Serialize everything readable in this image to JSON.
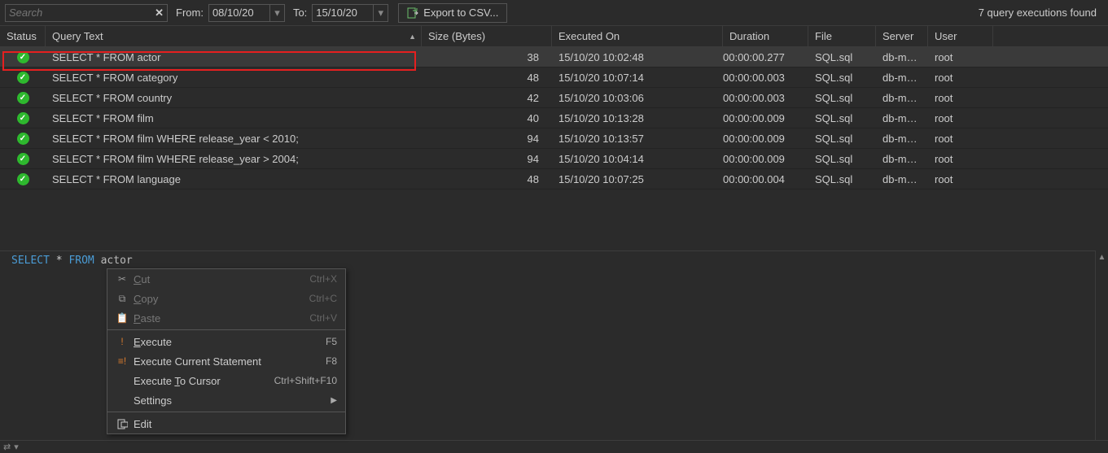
{
  "toolbar": {
    "search_placeholder": "Search",
    "from_label": "From:",
    "from_value": "08/10/20",
    "to_label": "To:",
    "to_value": "15/10/20",
    "export_label": "Export to CSV...",
    "count_label": "7 query executions found"
  },
  "columns": {
    "status": "Status",
    "query": "Query Text",
    "size": "Size (Bytes)",
    "executed": "Executed On",
    "duration": "Duration",
    "file": "File",
    "server": "Server",
    "user": "User"
  },
  "rows": [
    {
      "status": "ok",
      "query": "SELECT * FROM actor",
      "size": "38",
      "executed": "15/10/20 10:02:48",
      "duration": "00:00:00.277",
      "file": "SQL.sql",
      "server": "db-mysql...",
      "user": "root",
      "selected": true
    },
    {
      "status": "ok",
      "query": "SELECT * FROM category",
      "size": "48",
      "executed": "15/10/20 10:07:14",
      "duration": "00:00:00.003",
      "file": "SQL.sql",
      "server": "db-mysql...",
      "user": "root"
    },
    {
      "status": "ok",
      "query": "SELECT * FROM country",
      "size": "42",
      "executed": "15/10/20 10:03:06",
      "duration": "00:00:00.003",
      "file": "SQL.sql",
      "server": "db-mysql...",
      "user": "root"
    },
    {
      "status": "ok",
      "query": "SELECT * FROM film",
      "size": "40",
      "executed": "15/10/20 10:13:28",
      "duration": "00:00:00.009",
      "file": "SQL.sql",
      "server": "db-mysql...",
      "user": "root"
    },
    {
      "status": "ok",
      "query": "SELECT * FROM film WHERE release_year < 2010;",
      "size": "94",
      "executed": "15/10/20 10:13:57",
      "duration": "00:00:00.009",
      "file": "SQL.sql",
      "server": "db-mysql...",
      "user": "root"
    },
    {
      "status": "ok",
      "query": "SELECT * FROM film WHERE release_year > 2004;",
      "size": "94",
      "executed": "15/10/20 10:04:14",
      "duration": "00:00:00.009",
      "file": "SQL.sql",
      "server": "db-mysql...",
      "user": "root"
    },
    {
      "status": "ok",
      "query": "SELECT * FROM language",
      "size": "48",
      "executed": "15/10/20 10:07:25",
      "duration": "00:00:00.004",
      "file": "SQL.sql",
      "server": "db-mysql...",
      "user": "root"
    }
  ],
  "editor": {
    "kw_select": "SELECT",
    "star": "*",
    "kw_from": "FROM",
    "ident": "actor"
  },
  "context_menu": {
    "cut": {
      "label": "Cut",
      "shortcut": "Ctrl+X"
    },
    "copy": {
      "label": "Copy",
      "shortcut": "Ctrl+C"
    },
    "paste": {
      "label": "Paste",
      "shortcut": "Ctrl+V"
    },
    "execute": {
      "label": "Execute",
      "shortcut": "F5"
    },
    "execute_current": {
      "label": "Execute Current Statement",
      "shortcut": "F8"
    },
    "execute_to_cursor": {
      "label": "Execute To Cursor",
      "shortcut": "Ctrl+Shift+F10"
    },
    "settings": {
      "label": "Settings"
    },
    "edit": {
      "label": "Edit"
    }
  }
}
